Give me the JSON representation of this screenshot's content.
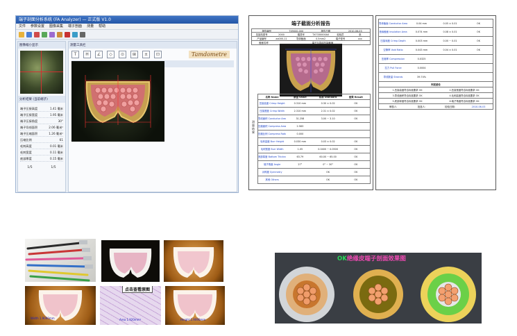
{
  "software": {
    "title": "端子剖面分析系统 (FA Analyzer) — 正式版 V1.0",
    "menu": [
      "文件",
      "参数设置",
      "图像采集",
      "端子剖面",
      "测量",
      "帮助"
    ],
    "left_panel_title": "图像缩小显示",
    "measure_title": "分析结果 (当前端子)",
    "measurements": [
      {
        "label": "端子压接高度",
        "value": "1.41 毫米"
      },
      {
        "label": "端子压接宽度",
        "value": "1.95 毫米"
      },
      {
        "label": "端子压接角度",
        "value": "30°"
      },
      {
        "label": "端子导线面积",
        "value": "2.06 毫米²"
      },
      {
        "label": "端子压缩面积",
        "value": "1.26 毫米²"
      },
      {
        "label": "压缩比例",
        "value": "61"
      },
      {
        "label": "毛刺高度",
        "value": "0.01 毫米"
      },
      {
        "label": "毛刺宽度",
        "value": "0.11 毫米"
      },
      {
        "label": "底部厚度",
        "value": "0.15 毫米"
      }
    ],
    "footer": [
      "1/5",
      "1/5"
    ],
    "image_panel_title": "测量工具栏",
    "viewer_title": "端子截面图像",
    "tool_glyphs": [
      "T",
      "H",
      "∠",
      "◇",
      "⊙",
      "⊞",
      "±",
      "⊡"
    ],
    "brand": "Tamdometre"
  },
  "report": {
    "title": "端子截面分析报告",
    "header_rows": [
      [
        "报告编号",
        "TX9000-000",
        "报告日期",
        "2010-06-03"
      ],
      [
        "压接机型号",
        "2000",
        "模具号",
        "TX7330000A0",
        "检验员",
        "张"
      ],
      [
        "产品编号",
        "aa000-11",
        "导体截面",
        "0.5mm2",
        "端子型号",
        "xxx"
      ],
      [
        "截面名称",
        "端子与导线压接截面"
      ]
    ],
    "side_label": "测量结果",
    "columns": [
      "名称 Name",
      "数值 Value",
      "标准 Standard",
      "结果 Result"
    ],
    "rows": [
      [
        "压接高度 Crimp Height",
        "0.310 mm",
        "0.30 ± 0.02",
        "OK"
      ],
      [
        "压接宽度 Crimp Width",
        "2.310 mm",
        "2.31 ± 0.02",
        "OK"
      ],
      [
        "导线面积 Conductor Area",
        "31.258",
        "3.00 ~ 3.10",
        "OK"
      ],
      [
        "压缩面积 Compress Area",
        "2.583",
        "",
        ""
      ],
      [
        "压缩比例 Compress Ratio",
        "0.000",
        "",
        ""
      ],
      [
        "毛刺高度 Burr Height",
        "0.030 mm",
        "0.03 ± 0.02",
        "OK"
      ],
      [
        "毛刺宽度 Burr Width",
        "1.05",
        "0.0400 ~ 0.0500",
        "OK"
      ],
      [
        "底部厚度 Bottom Thickness",
        "63.79",
        "60.00 ~ 65.00",
        "OK"
      ],
      [
        "端子角度 Angle",
        "27°",
        "0° ~ 30°",
        "OK"
      ],
      [
        "对称度 Symmetry",
        "",
        "OK",
        "OK"
      ],
      [
        "其他 Others",
        "",
        "OK",
        "OK"
      ]
    ],
    "page2_rows": [
      [
        "导体截面 Conductor Area",
        "0.04 mm",
        "0.05 ± 0.01",
        "OK"
      ],
      [
        "绝缘截面 Insulation Area",
        "0.074 mm",
        "0.08 ± 0.01",
        "OK"
      ],
      [
        "压接深度 Crimp Depth",
        "0.003 mm",
        "0.00 ~ 0.01",
        "OK"
      ],
      [
        "空隙率 Void Ratio",
        "0.043 mm",
        "0.04 ± 0.01",
        "OK"
      ],
      [
        "压缩率 Compression",
        "0.0325",
        "",
        ""
      ],
      [
        "拉力 Pull Force",
        "0.0004",
        "",
        ""
      ],
      [
        "导线数量 Strands",
        "39.74%",
        "",
        ""
      ]
    ],
    "conclusion_title": "判定结论",
    "conclusions": [
      "1.压接高度符合标准要求 OK",
      "2.压接宽度符合标准要求 OK",
      "3.导线面积符合标准要求 OK",
      "4.毛刺高度符合标准要求 OK",
      "5.底部厚度符合标准要求 OK",
      "6.端子角度符合标准要求 OK"
    ],
    "sign_labels": [
      "审核人:",
      "批准人:",
      "检验日期:"
    ],
    "sign_date": "2010-06-03"
  },
  "gallery": {
    "click_caption": "点击查看原图",
    "labels": [
      "Width 1.9090mm",
      "Area 1.920mm²",
      "Width 1.9090mm",
      "Height 1.9090mm"
    ]
  },
  "insulation": {
    "ok": "OK",
    "title": "绝缘皮端子剖面效果图"
  }
}
